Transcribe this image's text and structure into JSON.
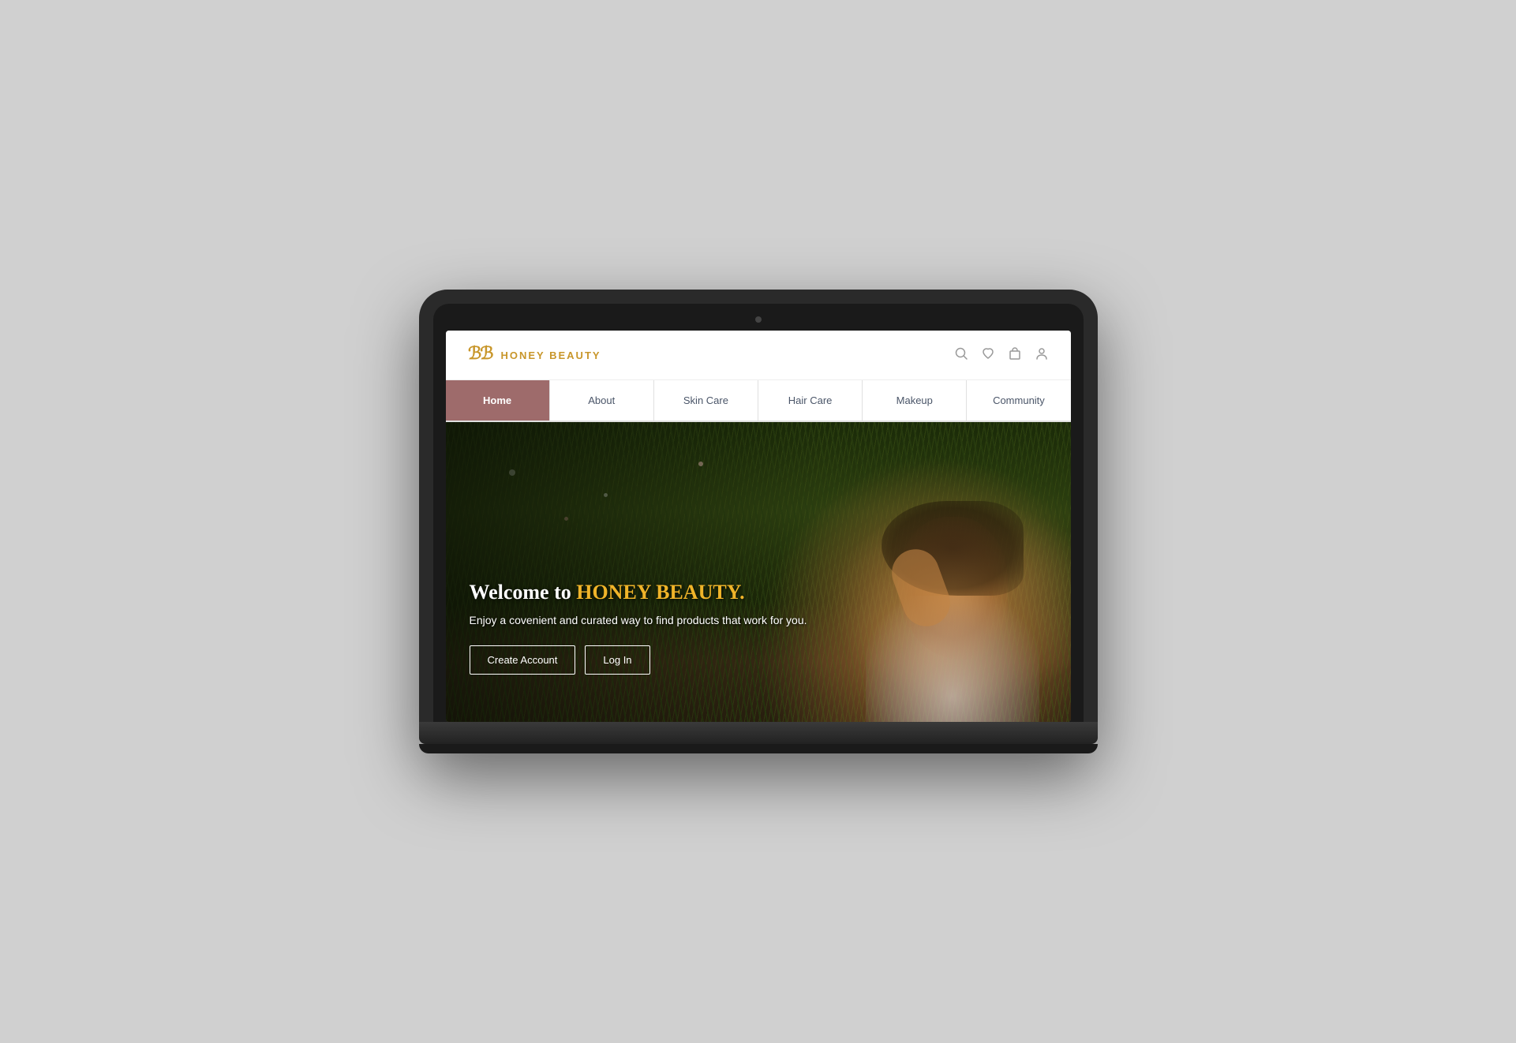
{
  "logo": {
    "icon": "ℍ𝔹",
    "text": "HONEY BEAUTY"
  },
  "header": {
    "icons": [
      "search",
      "heart",
      "bag",
      "user"
    ]
  },
  "nav": {
    "items": [
      {
        "label": "Home",
        "active": true
      },
      {
        "label": "About",
        "active": false
      },
      {
        "label": "Skin Care",
        "active": false
      },
      {
        "label": "Hair Care",
        "active": false
      },
      {
        "label": "Makeup",
        "active": false
      },
      {
        "label": "Community",
        "active": false
      }
    ]
  },
  "hero": {
    "title_prefix": "Welcome to ",
    "title_brand": "HONEY BEAUTY.",
    "subtitle": "Enjoy a covenient and curated way to find products that work for you.",
    "btn_create": "Create Account",
    "btn_login": "Log In"
  }
}
